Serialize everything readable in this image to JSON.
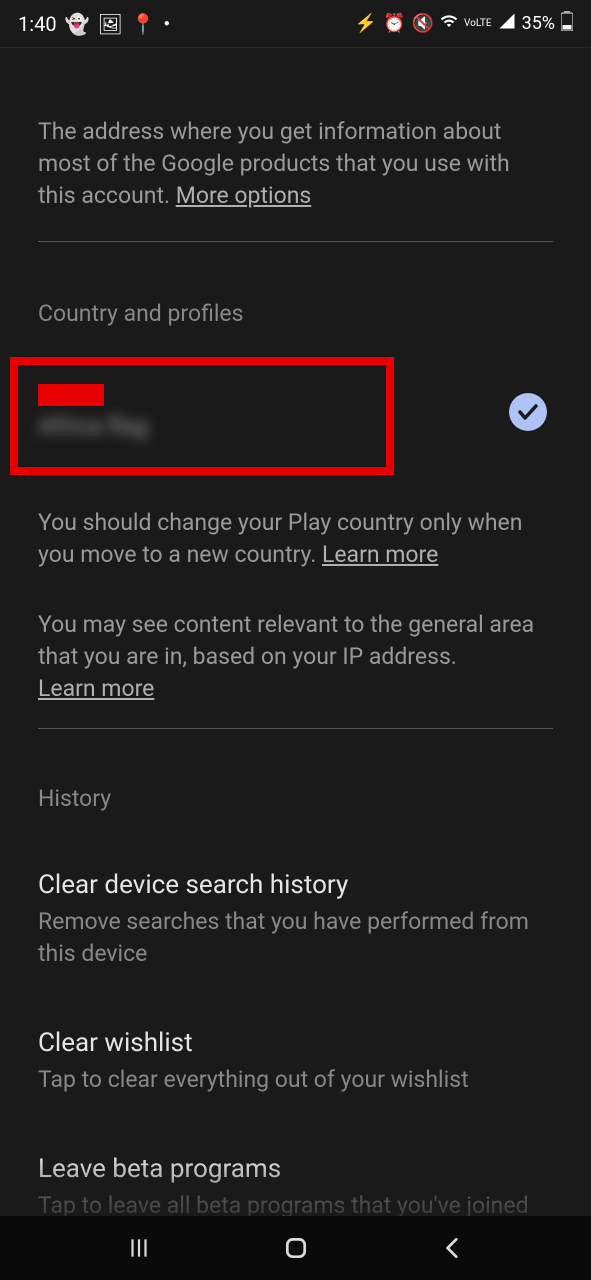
{
  "status": {
    "time": "1:40",
    "battery": "35%"
  },
  "intro": {
    "text": "The address where you get information about most of the Google products that you use with this account. ",
    "link": "More options"
  },
  "country": {
    "heading": "Country and profiles",
    "redacted_primary": "",
    "redacted_secondary": "Africa flag",
    "desc1_text": "You should change your Play country only when you move to a new country. ",
    "desc1_link": "Learn more",
    "desc2_text": "You may see content relevant to the general area that you are in, based on your IP address. ",
    "desc2_link": "Learn more"
  },
  "history": {
    "heading": "History",
    "items": [
      {
        "title": "Clear device search history",
        "sub": "Remove searches that you have performed from this device"
      },
      {
        "title": "Clear wishlist",
        "sub": "Tap to clear everything out of your wishlist"
      },
      {
        "title": "Leave beta programs",
        "sub": "Tap to leave all beta programs that you've joined"
      }
    ]
  }
}
